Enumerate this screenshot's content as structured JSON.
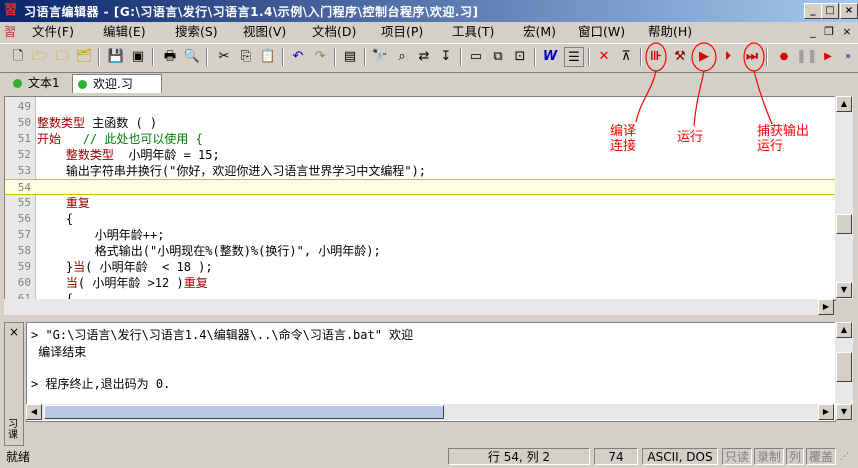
{
  "window": {
    "title": "习语言编辑器 - [G:\\习语言\\发行\\习语言1.4\\示例\\入门程序\\控制台程序\\欢迎.习]",
    "controls": [
      "_",
      "□",
      "×"
    ]
  },
  "menu": {
    "items": [
      "文件(F)",
      "编辑(E)",
      "搜索(S)",
      "视图(V)",
      "文档(D)",
      "项目(P)",
      "工具(T)",
      "宏(M)",
      "窗口(W)",
      "帮助(H)"
    ],
    "mdi_controls": [
      "_",
      "❐",
      "×"
    ]
  },
  "tabs": [
    {
      "label": "文本1",
      "active": false
    },
    {
      "label": "欢迎.习",
      "active": true
    }
  ],
  "editor": {
    "lines": [
      {
        "num": "49",
        "code": ""
      },
      {
        "num": "50",
        "kw": "整数类型",
        "code": " 主函数 ( )"
      },
      {
        "num": "51",
        "kw": "开始",
        "code": "   ",
        "comment": "// 此处也可以使用 {"
      },
      {
        "num": "52",
        "kw": "    整数类型",
        "code": "  小明年龄 = 15;"
      },
      {
        "num": "53",
        "code": "    输出字符串并换行(\"你好，欢迎你进入习语言世界学习中文编程\");"
      },
      {
        "num": "54",
        "code": ""
      },
      {
        "num": "55",
        "kw": "    重复",
        "code": ""
      },
      {
        "num": "56",
        "code": "    {"
      },
      {
        "num": "57",
        "code": "        小明年龄++;"
      },
      {
        "num": "58",
        "code": "        格式输出(\"小明现在%(整数)%(换行)\", 小明年龄);"
      },
      {
        "num": "59",
        "code": "    }",
        "kw2": "当",
        "code2": "( 小明年龄  < 18 );"
      },
      {
        "num": "60",
        "kw": "    当",
        "code": "( 小明年龄 >12 )",
        "kw2": "重复",
        "code2": ""
      },
      {
        "num": "61",
        "code": "    {"
      }
    ],
    "current_line": "54"
  },
  "annotations": {
    "compile": [
      "编译",
      "连接"
    ],
    "run": [
      "运行"
    ],
    "capture": [
      "捕获输出",
      "运行"
    ]
  },
  "output": {
    "side_close": "×",
    "side_label": "习\n课",
    "lines": [
      "> \"G:\\习语言\\发行\\习语言1.4\\编辑器\\..\\命令\\习语言.bat\" 欢迎",
      " 编译结束",
      "",
      "> 程序终止,退出码为 0."
    ]
  },
  "status": {
    "ready": "就绪",
    "position": "行 54, 列 2",
    "count": "74",
    "encoding": "ASCII, DOS",
    "readonly": "只读",
    "record": "录制",
    "column": "列",
    "overwrite": "覆盖"
  },
  "colors": {
    "keyword": "#a00000",
    "comment": "#008000",
    "annotation": "#ff0000",
    "title_start": "#0a246a"
  }
}
